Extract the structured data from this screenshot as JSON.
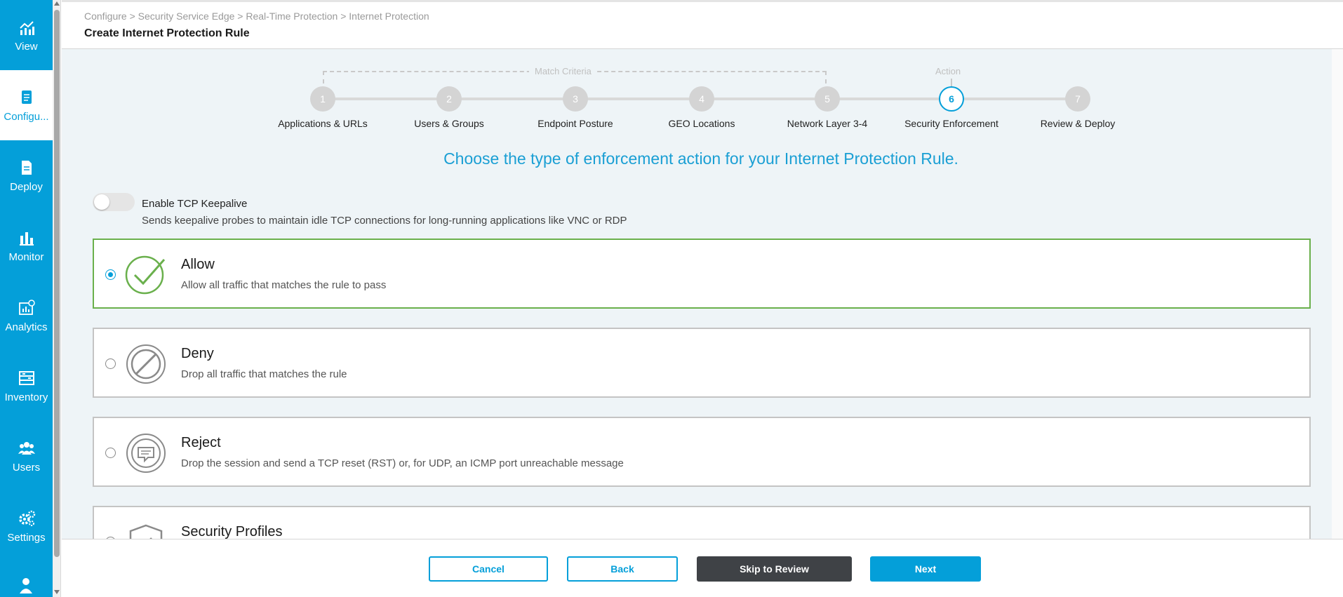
{
  "sidebar": {
    "items": [
      {
        "label": "View",
        "icon": "view-chart-icon",
        "active": false
      },
      {
        "label": "Configu...",
        "icon": "configure-document-icon",
        "active": true
      },
      {
        "label": "Deploy",
        "icon": "deploy-document-icon",
        "active": false
      },
      {
        "label": "Monitor",
        "icon": "monitor-bar-chart-icon",
        "active": false
      },
      {
        "label": "Analytics",
        "icon": "analytics-icon",
        "active": false
      },
      {
        "label": "Inventory",
        "icon": "inventory-icon",
        "active": false
      },
      {
        "label": "Users",
        "icon": "users-icon",
        "active": false
      },
      {
        "label": "Settings",
        "icon": "settings-gears-icon",
        "active": false
      }
    ]
  },
  "header": {
    "breadcrumb": "Configure > Security Service Edge > Real-Time Protection > Internet Protection",
    "title": "Create Internet Protection Rule"
  },
  "stepper": {
    "match_criteria_label": "Match Criteria",
    "action_label": "Action",
    "current_step": 6,
    "steps": [
      {
        "number": "1",
        "label": "Applications & URLs"
      },
      {
        "number": "2",
        "label": "Users & Groups"
      },
      {
        "number": "3",
        "label": "Endpoint Posture"
      },
      {
        "number": "4",
        "label": "GEO Locations"
      },
      {
        "number": "5",
        "label": "Network Layer 3-4"
      },
      {
        "number": "6",
        "label": "Security Enforcement"
      },
      {
        "number": "7",
        "label": "Review & Deploy"
      }
    ]
  },
  "prompt": "Choose the type of enforcement action for your Internet Protection Rule.",
  "keepalive": {
    "label": "Enable TCP Keepalive",
    "description": "Sends keepalive probes to maintain idle TCP connections for long-running applications like VNC or RDP",
    "enabled": false
  },
  "actions": [
    {
      "title": "Allow",
      "description": "Allow all traffic that matches the rule to pass",
      "selected": true,
      "icon": "allow-check-icon"
    },
    {
      "title": "Deny",
      "description": "Drop all traffic that matches the rule",
      "selected": false,
      "icon": "deny-block-icon"
    },
    {
      "title": "Reject",
      "description": "Drop the session and send a TCP reset (RST) or, for UDP, an ICMP port unreachable message",
      "selected": false,
      "icon": "reject-message-icon"
    },
    {
      "title": "Security Profiles",
      "description": "",
      "selected": false,
      "icon": "security-profile-shield-icon"
    }
  ],
  "footer": {
    "cancel_label": "Cancel",
    "back_label": "Back",
    "skip_label": "Skip to Review",
    "next_label": "Next"
  },
  "colors": {
    "brand": "#049fd9",
    "selected_border": "#6ab04c",
    "dark_button": "#3f4246"
  }
}
